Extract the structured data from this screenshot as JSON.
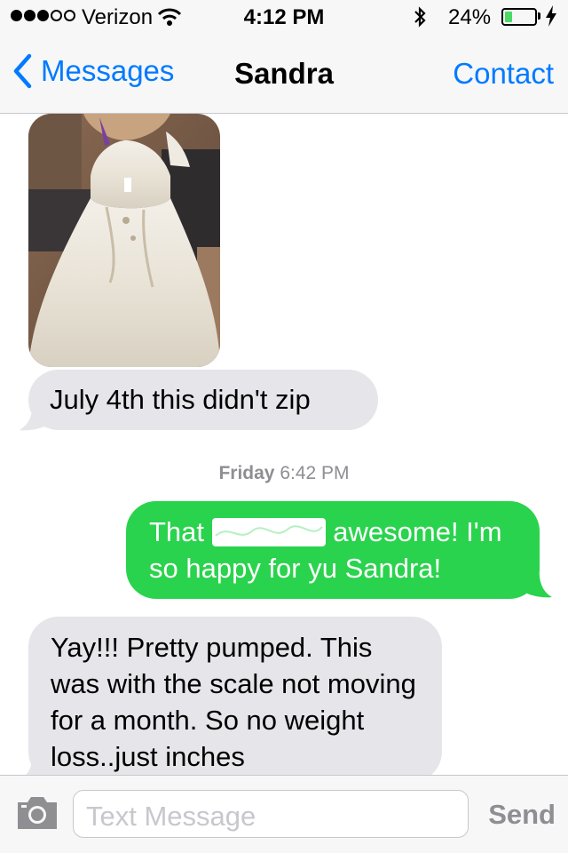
{
  "status_bar": {
    "carrier": "Verizon",
    "time": "4:12 PM",
    "battery_percent": "24%",
    "battery_level": 0.24,
    "signal_bars": 3,
    "signal_max": 5,
    "icons": [
      "signal-dots-icon",
      "wifi-icon",
      "bluetooth-icon",
      "battery-icon",
      "charging-bolt-icon"
    ]
  },
  "nav": {
    "back_label": "Messages",
    "title": "Sandra",
    "contact_label": "Contact"
  },
  "messages": [
    {
      "type": "image",
      "direction": "incoming",
      "description": "photo attachment"
    },
    {
      "type": "text",
      "direction": "incoming",
      "text": "July 4th this didn't zip"
    },
    {
      "type": "timestamp",
      "day": "Friday",
      "time": "6:42 PM"
    },
    {
      "type": "text",
      "direction": "outgoing",
      "text_before": "That",
      "text_after": "awesome! I'm so happy for yu Sandra!"
    },
    {
      "type": "text",
      "direction": "incoming",
      "text": "Yay!!! Pretty pumped. This was with the scale not moving for a month. So no weight loss..just inches"
    }
  ],
  "composer": {
    "placeholder": "Text Message",
    "send_label": "Send"
  },
  "colors": {
    "ios_blue": "#007aff",
    "outgoing_green": "#2ad34d",
    "incoming_gray": "#e5e5ea",
    "bar_background": "#f7f7f7"
  }
}
